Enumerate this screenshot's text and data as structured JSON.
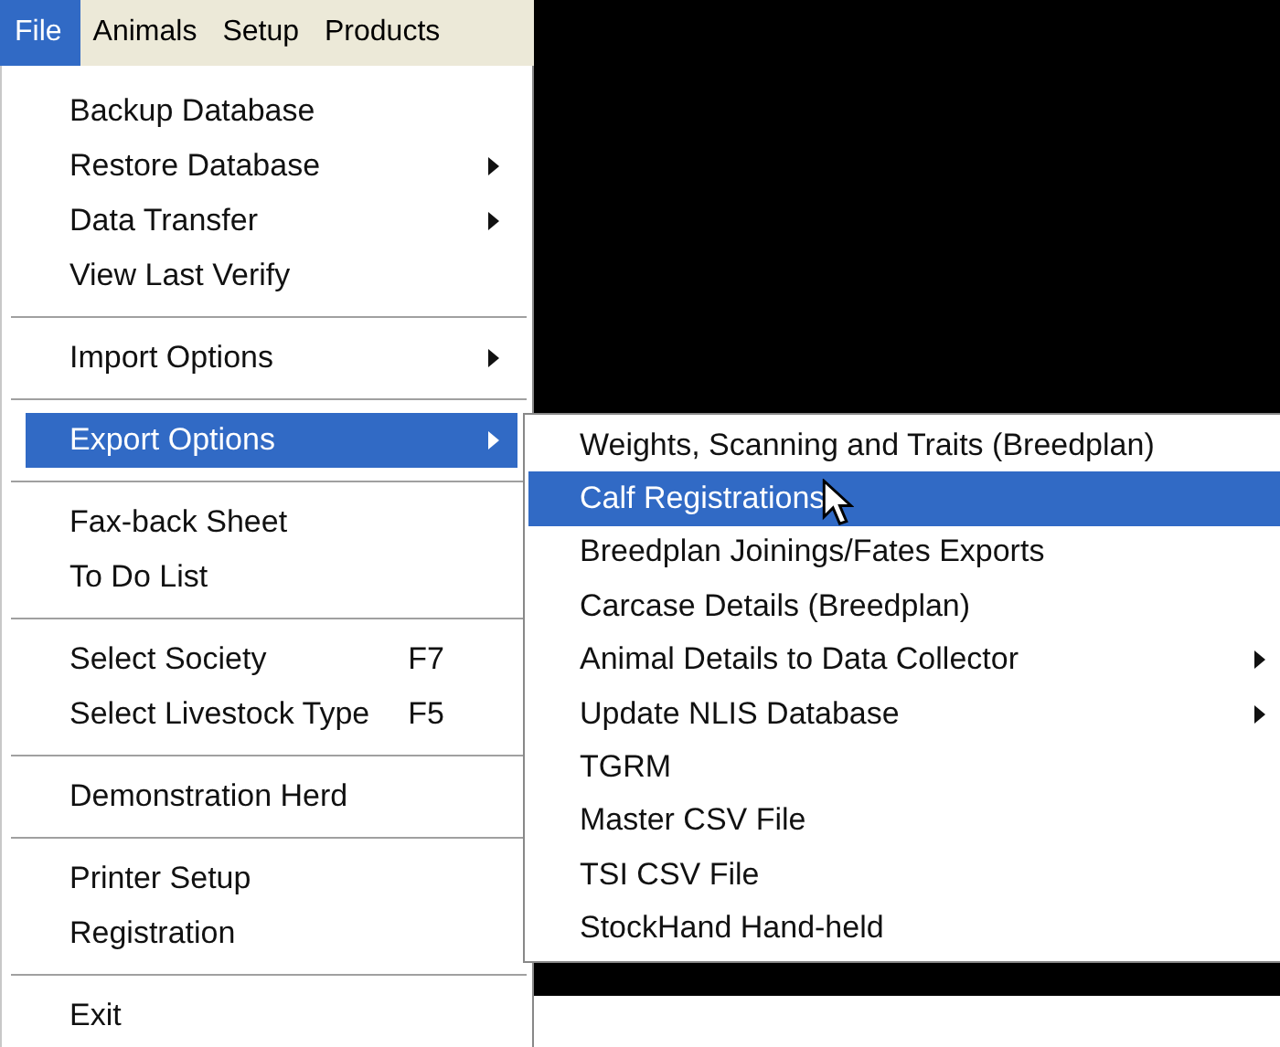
{
  "menu_bar": [
    {
      "label": "File",
      "selected": true
    },
    {
      "label": "Animals",
      "selected": false
    },
    {
      "label": "Setup",
      "selected": false
    },
    {
      "label": "Products",
      "selected": false
    }
  ],
  "file_menu": {
    "groups": [
      [
        {
          "label": "Backup Database",
          "has_submenu": false,
          "selected": false
        },
        {
          "label": "Restore Database",
          "has_submenu": true,
          "selected": false
        },
        {
          "label": "Data Transfer",
          "has_submenu": true,
          "selected": false
        },
        {
          "label": "View Last Verify",
          "has_submenu": false,
          "selected": false
        }
      ],
      [
        {
          "label": "Import Options",
          "has_submenu": true,
          "selected": false
        }
      ],
      [
        {
          "label": "Export Options",
          "has_submenu": true,
          "selected": true
        }
      ],
      [
        {
          "label": "Fax-back Sheet",
          "has_submenu": false,
          "selected": false
        },
        {
          "label": "To Do List",
          "has_submenu": false,
          "selected": false
        }
      ],
      [
        {
          "label": "Select Society",
          "shortcut": "F7",
          "has_submenu": false,
          "selected": false
        },
        {
          "label": "Select Livestock Type",
          "shortcut": "F5",
          "has_submenu": false,
          "selected": false
        }
      ],
      [
        {
          "label": "Demonstration Herd",
          "has_submenu": false,
          "selected": false
        }
      ],
      [
        {
          "label": "Printer Setup",
          "has_submenu": false,
          "selected": false
        },
        {
          "label": "Registration",
          "has_submenu": false,
          "selected": false
        }
      ],
      [
        {
          "label": "Exit",
          "has_submenu": false,
          "selected": false
        }
      ]
    ]
  },
  "export_submenu": {
    "items": [
      {
        "label": "Weights, Scanning and Traits (Breedplan)",
        "has_submenu": false,
        "selected": false
      },
      {
        "label": "Calf Registrations",
        "has_submenu": false,
        "selected": true
      },
      {
        "label": "Breedplan Joinings/Fates Exports",
        "has_submenu": false,
        "selected": false
      },
      {
        "label": "Carcase Details (Breedplan)",
        "has_submenu": false,
        "selected": false
      },
      {
        "label": "Animal Details to Data Collector",
        "has_submenu": true,
        "selected": false
      },
      {
        "label": "Update NLIS Database",
        "has_submenu": true,
        "selected": false
      },
      {
        "label": "TGRM",
        "has_submenu": false,
        "selected": false
      },
      {
        "label": "Master CSV File",
        "has_submenu": false,
        "selected": false
      },
      {
        "label": "TSI CSV File",
        "has_submenu": false,
        "selected": false
      },
      {
        "label": "StockHand Hand-held",
        "has_submenu": false,
        "selected": false
      }
    ]
  }
}
